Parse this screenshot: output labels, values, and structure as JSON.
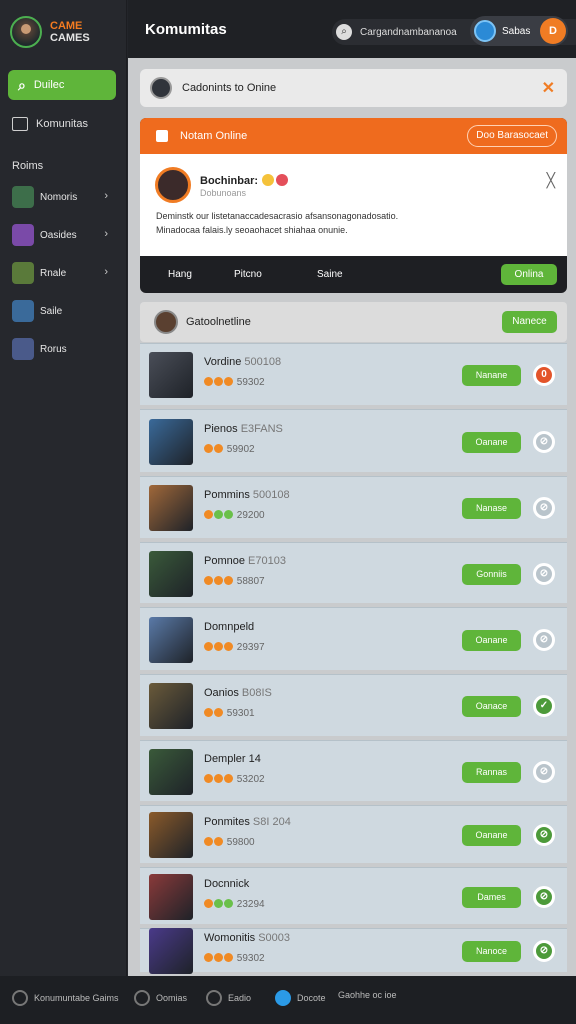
{
  "sidebar": {
    "logo_top": "CAME",
    "logo_bottom": "CAMES",
    "active_item": "Duilec",
    "community_item": "Komunitas",
    "section_title": "Roims",
    "friends": [
      {
        "label": "Nomoris",
        "color": "#3d6e4a",
        "chevron": "›"
      },
      {
        "label": "Oasides",
        "color": "#7a4aa8",
        "chevron": "›"
      },
      {
        "label": "Rnale",
        "color": "#5a7a3a",
        "chevron": "›"
      },
      {
        "label": "Saile",
        "color": "#3a6a9a",
        "chevron": ""
      },
      {
        "label": "Rorus",
        "color": "#4a5a8a",
        "chevron": ""
      }
    ]
  },
  "topbar": {
    "title": "Komumitas",
    "search_text": "Cargandnambananoa",
    "user_label": "Sabas",
    "user_initial": "D"
  },
  "card1": {
    "text": "Cadonints to Onine",
    "close": "✕"
  },
  "card2": {
    "header": "Notam Online",
    "header_button": "Doo Barasocaet",
    "name": "Bochinbar:",
    "sub": "Dobunoans",
    "desc_line1": "Deminstk our listetanaccadesacrasio afsansonagonadosatio.",
    "desc_line2": "Minadocaa falais.ly seoaohacet shiahaa onunie.",
    "tab1": "Hang",
    "tab2": "Pitcno",
    "tab3": "Saine",
    "footer_button": "Onlina"
  },
  "list_header": {
    "text": "Gatoolnetline",
    "button": "Nanece"
  },
  "rows": [
    {
      "name": "Vordine",
      "tag": "500108",
      "score": "59302",
      "action": "Nanane",
      "status": "0",
      "pic": "#4a4e58",
      "scolor": "#e3542a",
      "stars": [
        "#f08a24",
        "#f08a24",
        "#f08a24"
      ]
    },
    {
      "name": "Pienos",
      "tag": "E3FANS",
      "score": "59902",
      "action": "Oanane",
      "status": "⊘",
      "pic": "#3a6a9a",
      "scolor": "#b9c4cb",
      "stars": [
        "#f08a24",
        "#f08a24"
      ]
    },
    {
      "name": "Pommins",
      "tag": "500108",
      "score": "29200",
      "action": "Nanase",
      "status": "⊘",
      "pic": "#a0683a",
      "scolor": "#b9c4cb",
      "stars": [
        "#f08a24",
        "#6ac04a",
        "#6ac04a"
      ]
    },
    {
      "name": "Pomnoe",
      "tag": "E70103",
      "score": "58807",
      "action": "Gonniis",
      "status": "⊘",
      "pic": "#3a5a3a",
      "scolor": "#b9c4cb",
      "stars": [
        "#f08a24",
        "#f08a24",
        "#f08a24"
      ]
    },
    {
      "name": "Domnpeld",
      "tag": "",
      "score": "29397",
      "action": "Oanane",
      "status": "⊘",
      "pic": "#5a7aa8",
      "scolor": "#b9c4cb",
      "stars": [
        "#f08a24",
        "#f08a24",
        "#f08a24"
      ]
    },
    {
      "name": "Oanios",
      "tag": "B08IS",
      "score": "59301",
      "action": "Oanace",
      "status": "✓",
      "pic": "#6a5a3a",
      "scolor": "#4c9a3a",
      "stars": [
        "#f08a24",
        "#f08a24"
      ]
    },
    {
      "name": "Dempler 14",
      "tag": "",
      "score": "53202",
      "action": "Rannas",
      "status": "⊘",
      "pic": "#3a5a3a",
      "scolor": "#b9c4cb",
      "stars": [
        "#f08a24",
        "#f08a24",
        "#f08a24"
      ]
    },
    {
      "name": "Ponmites",
      "tag": "S8I 204",
      "score": "59800",
      "action": "Oanane",
      "status": "⊘",
      "pic": "#8a5a2a",
      "scolor": "#4c9a3a",
      "stars": [
        "#f08a24",
        "#f08a24"
      ]
    },
    {
      "name": "Docnnick",
      "tag": "",
      "score": "23294",
      "action": "Dames",
      "status": "⊘",
      "pic": "#8a3a3a",
      "scolor": "#4c9a3a",
      "stars": [
        "#f08a24",
        "#6ac04a",
        "#6ac04a"
      ]
    },
    {
      "name": "Womonitis",
      "tag": "S0003",
      "score": "59302",
      "action": "Nanoce",
      "status": "⊘",
      "pic": "#4a3a8a",
      "scolor": "#4c9a3a",
      "stars": [
        "#f08a24",
        "#f08a24",
        "#f08a24"
      ]
    }
  ],
  "bottom": {
    "item1": "Konumuntabe Gaims",
    "item2": "Oomias",
    "item3": "Eadio",
    "item4": "Docote",
    "item5": "Gaohhe oc ioe"
  }
}
